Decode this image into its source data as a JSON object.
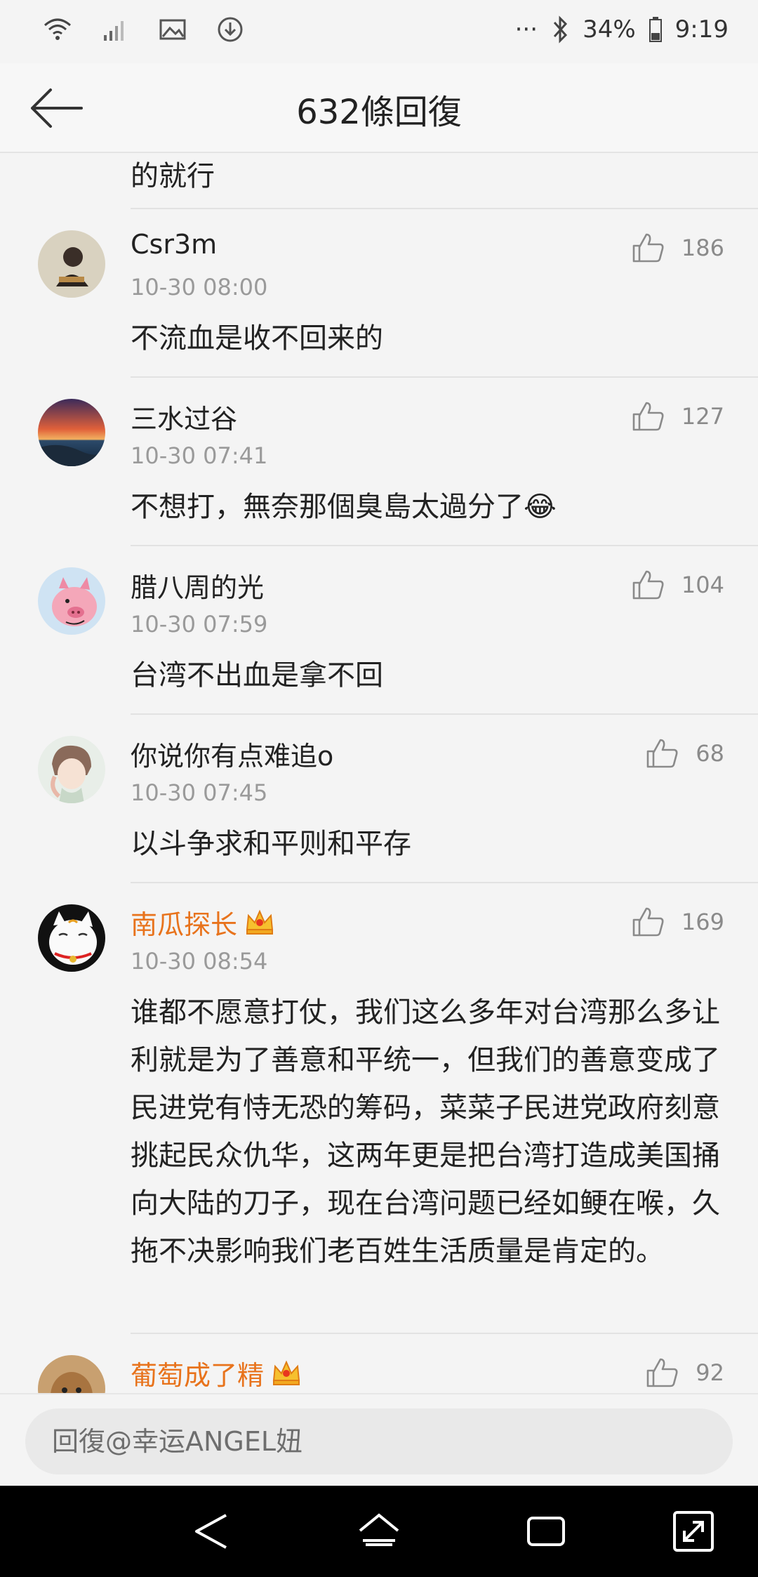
{
  "status": {
    "battery": "34%",
    "time": "9:19",
    "more": "···"
  },
  "header": {
    "title": "632條回復"
  },
  "partial_top_text": "的就行",
  "comments": [
    {
      "name": "Csr3m",
      "time": "10-30 08:00",
      "likes": "186",
      "text": "不流血是收不回来的",
      "vip": false
    },
    {
      "name": "三水过谷",
      "time": "10-30 07:41",
      "likes": "127",
      "text": "不想打，無奈那個臭島太過分了😂",
      "vip": false
    },
    {
      "name": "腊八周的光",
      "time": "10-30 07:59",
      "likes": "104",
      "text": "台湾不出血是拿不回",
      "vip": false
    },
    {
      "name": "你说你有点难追o",
      "time": "10-30 07:45",
      "likes": "68",
      "text": "以斗争求和平则和平存",
      "vip": false
    },
    {
      "name": "南瓜探长",
      "time": "10-30 08:54",
      "likes": "169",
      "text": "谁都不愿意打仗，我们这么多年对台湾那么多让利就是为了善意和平统一，但我们的善意变成了民进党有恃无恐的筹码，菜菜子民进党政府刻意挑起民众仇华，这两年更是把台湾打造成美国捅向大陆的刀子，现在台湾问题已经如鲠在喉，久拖不决影响我们老百姓生活质量是肯定的。",
      "vip": true
    },
    {
      "name": "葡萄成了精",
      "time": "",
      "likes": "92",
      "text": "",
      "vip": true
    }
  ],
  "reply": {
    "placeholder": "回復@幸运ANGEL妞"
  },
  "colors": {
    "vip_name": "#e8731c",
    "meta": "#9a9a9a",
    "background": "#f4f4f4"
  }
}
